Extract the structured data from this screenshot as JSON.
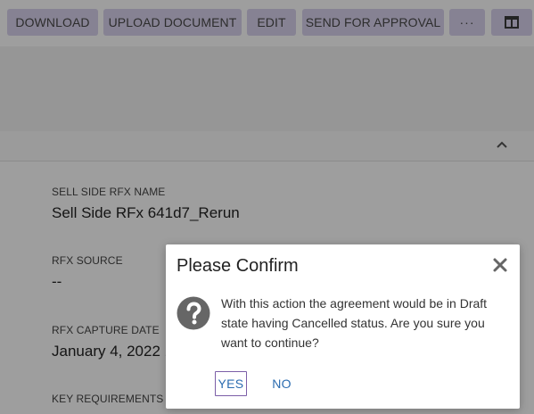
{
  "toolbar": {
    "download": "DOWNLOAD",
    "upload_document": "UPLOAD DOCUMENT",
    "edit": "EDIT",
    "send_for_approval": "SEND FOR APPROVAL",
    "more": "···",
    "more_icon": "more-horizontal-icon",
    "layout_icon": "split-view-icon"
  },
  "section": {
    "collapse_icon": "chevron-up-icon"
  },
  "fields": [
    {
      "label": "SELL SIDE RFX NAME",
      "value": "Sell Side RFx 641d7_Rerun"
    },
    {
      "label": "RFX SOURCE",
      "value": "--"
    },
    {
      "label": "RFX CAPTURE DATE",
      "value": "January 4, 2022 1"
    },
    {
      "label": "KEY REQUIREMENTS",
      "value": ""
    }
  ],
  "dialog": {
    "title": "Please Confirm",
    "message": "With this action the agreement would be in Draft state having Cancelled status. Are you sure you want to continue?",
    "yes": "YES",
    "no": "NO",
    "close_icon": "close-icon",
    "info_icon": "question-circle-icon"
  },
  "colors": {
    "toolbar_button_bg": "#d9d2ee",
    "link": "#2b6cb0",
    "focus_border": "#7b5ea7"
  }
}
